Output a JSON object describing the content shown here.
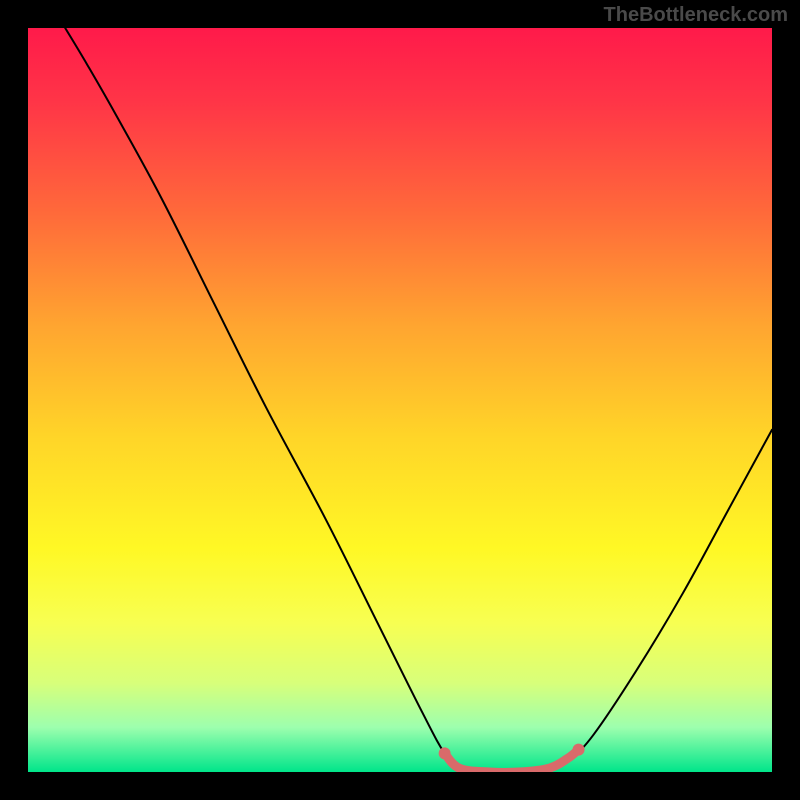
{
  "watermark": "TheBottleneck.com",
  "chart_data": {
    "type": "line",
    "title": "",
    "xlabel": "",
    "ylabel": "",
    "xlim": [
      0,
      100
    ],
    "ylim": [
      0,
      100
    ],
    "background_gradient": {
      "stops": [
        {
          "offset": 0.0,
          "color": "#ff1a4a"
        },
        {
          "offset": 0.1,
          "color": "#ff3547"
        },
        {
          "offset": 0.25,
          "color": "#ff6a3a"
        },
        {
          "offset": 0.4,
          "color": "#ffa530"
        },
        {
          "offset": 0.55,
          "color": "#ffd528"
        },
        {
          "offset": 0.7,
          "color": "#fff825"
        },
        {
          "offset": 0.8,
          "color": "#f7ff52"
        },
        {
          "offset": 0.88,
          "color": "#d8ff7a"
        },
        {
          "offset": 0.94,
          "color": "#9dffae"
        },
        {
          "offset": 1.0,
          "color": "#00e58a"
        }
      ]
    },
    "series": [
      {
        "name": "bottleneck-curve",
        "color": "#000000",
        "width": 2,
        "points": [
          {
            "x": 5.0,
            "y": 100.0
          },
          {
            "x": 8.0,
            "y": 95.0
          },
          {
            "x": 12.0,
            "y": 88.0
          },
          {
            "x": 18.0,
            "y": 77.0
          },
          {
            "x": 25.0,
            "y": 63.0
          },
          {
            "x": 32.0,
            "y": 49.0
          },
          {
            "x": 40.0,
            "y": 34.0
          },
          {
            "x": 47.0,
            "y": 20.0
          },
          {
            "x": 53.0,
            "y": 8.0
          },
          {
            "x": 56.0,
            "y": 2.5
          },
          {
            "x": 58.0,
            "y": 0.5
          },
          {
            "x": 62.0,
            "y": 0.0
          },
          {
            "x": 66.0,
            "y": 0.0
          },
          {
            "x": 70.0,
            "y": 0.5
          },
          {
            "x": 73.0,
            "y": 2.0
          },
          {
            "x": 76.0,
            "y": 5.0
          },
          {
            "x": 82.0,
            "y": 14.0
          },
          {
            "x": 88.0,
            "y": 24.0
          },
          {
            "x": 94.0,
            "y": 35.0
          },
          {
            "x": 100.0,
            "y": 46.0
          }
        ]
      },
      {
        "name": "optimal-range-highlight",
        "color": "#d96a6a",
        "width": 9,
        "points": [
          {
            "x": 56.0,
            "y": 2.5
          },
          {
            "x": 58.0,
            "y": 0.5
          },
          {
            "x": 62.0,
            "y": 0.0
          },
          {
            "x": 66.0,
            "y": 0.0
          },
          {
            "x": 70.0,
            "y": 0.5
          },
          {
            "x": 72.5,
            "y": 1.8
          },
          {
            "x": 74.0,
            "y": 3.0
          }
        ]
      }
    ],
    "markers": [
      {
        "name": "optimal-start-dot",
        "x": 56.0,
        "y": 2.5,
        "r": 6,
        "color": "#d96a6a"
      },
      {
        "name": "optimal-end-dot",
        "x": 74.0,
        "y": 3.0,
        "r": 6,
        "color": "#d96a6a"
      }
    ]
  }
}
